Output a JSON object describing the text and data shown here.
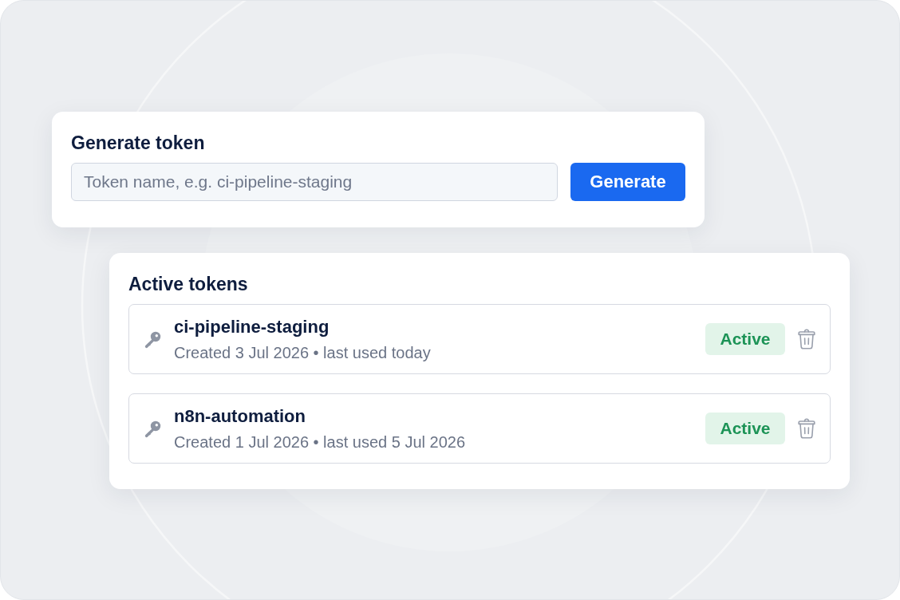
{
  "generate_card": {
    "title": "Generate token",
    "name_field": {
      "placeholder": "Token name, e.g. ci-pipeline-staging"
    },
    "button": "Generate"
  },
  "tokens_card": {
    "title": "Active tokens",
    "tokens": [
      {
        "name": "ci-pipeline-staging",
        "meta": "Created 3 Jul 2026 • last used today",
        "status": "Active"
      },
      {
        "name": "n8n-automation",
        "meta": "Created 1 Jul 2026 • last used 5 Jul 2026",
        "status": "Active"
      }
    ]
  }
}
